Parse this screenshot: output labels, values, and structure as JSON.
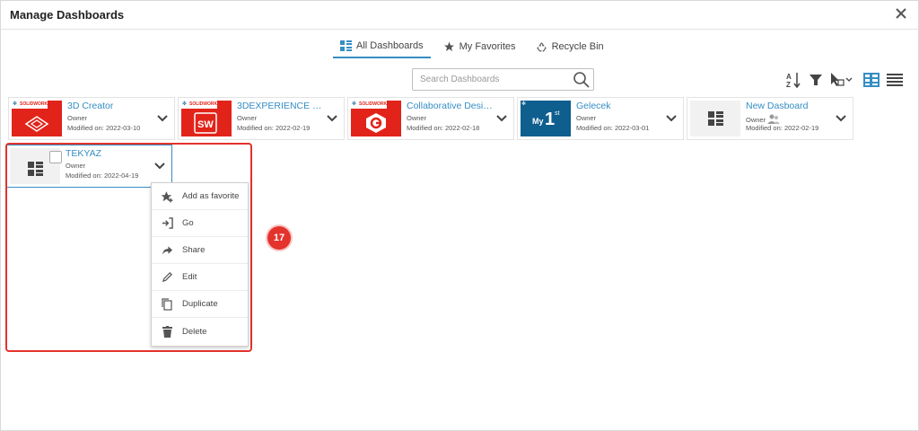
{
  "dialog": {
    "title": "Manage Dashboards",
    "close_icon": "close-icon"
  },
  "tabs": [
    {
      "label": "All Dashboards",
      "icon": "dashboard-grid-icon",
      "active": true
    },
    {
      "label": "My Favorites",
      "icon": "star-icon",
      "active": false
    },
    {
      "label": "Recycle Bin",
      "icon": "recycle-icon",
      "active": false
    }
  ],
  "search": {
    "placeholder": "Search Dashboards",
    "value": ""
  },
  "toolbar": {
    "icons": [
      "sort-az-icon",
      "filter-icon",
      "select-cursor-icon",
      "tile-view-icon",
      "list-view-icon"
    ]
  },
  "cards": [
    {
      "name": "3D Creator",
      "owner": "Owner",
      "modified": "Modified on: 2022-03-10",
      "thumb": "solidworks-3dcreator",
      "brand": "SOLIDWORKS"
    },
    {
      "name": "3DEXPERIENCE S...",
      "owner": "Owner",
      "modified": "Modified on: 2022-02-19",
      "thumb": "solidworks-sw",
      "brand": "SOLIDWORKS"
    },
    {
      "name": "Collaborative Desig...",
      "owner": "Owner",
      "modified": "Modified on: 2022-02-18",
      "thumb": "solidworks-collab",
      "brand": "SOLIDWORKS"
    },
    {
      "name": "Gelecek",
      "owner": "Owner",
      "modified": "Modified on: 2022-03-01",
      "thumb": "my1st",
      "thumb_text": "My",
      "thumb_big": "1",
      "thumb_sup": "st"
    },
    {
      "name": "New Dasboard",
      "owner": "Owner",
      "modified": "Modified on: 2022-02-19",
      "thumb": "generic"
    },
    {
      "name": "TEKYAZ",
      "owner": "Owner",
      "modified": "Modified on: 2022-04-19",
      "thumb": "generic"
    }
  ],
  "context_menu": [
    {
      "label": "Add as favorite",
      "icon": "star-add-icon"
    },
    {
      "label": "Go",
      "icon": "go-enter-icon"
    },
    {
      "label": "Share",
      "icon": "share-icon"
    },
    {
      "label": "Edit",
      "icon": "edit-pencil-icon"
    },
    {
      "label": "Duplicate",
      "icon": "duplicate-icon"
    },
    {
      "label": "Delete",
      "icon": "delete-trash-icon"
    }
  ],
  "annotation": {
    "badge": "17"
  },
  "colors": {
    "accent": "#368ec4",
    "brand_red": "#e2231a",
    "highlight": "#e3332c",
    "thumb_blue": "#0e5e8e"
  }
}
